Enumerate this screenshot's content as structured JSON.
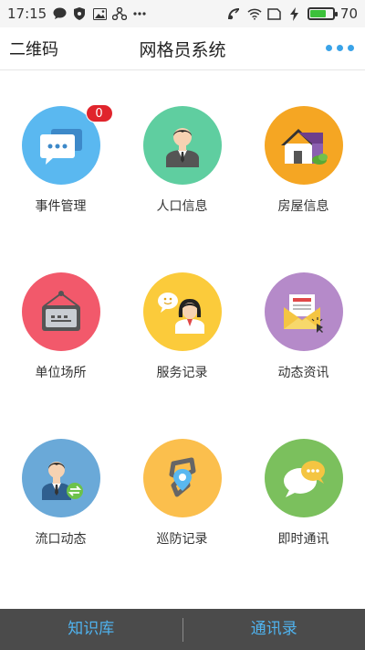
{
  "statusbar": {
    "time": "17:15",
    "left_icons": [
      "message-icon",
      "shield-icon",
      "image-icon",
      "usb-icon",
      "more-dots-icon"
    ],
    "right_icons": [
      "nfc-icon",
      "wifi-icon",
      "sim-icon",
      "charging-icon"
    ],
    "battery_level": 70,
    "battery_text": "70"
  },
  "header": {
    "left_label": "二维码",
    "title": "网格员系统",
    "more_icon": "more-dots-icon"
  },
  "tiles": [
    {
      "label": "事件管理",
      "icon": "chat-bubbles-icon",
      "color": "#5ab8f0",
      "badge": "0"
    },
    {
      "label": "人口信息",
      "icon": "person-suit-icon",
      "color": "#5fcea0"
    },
    {
      "label": "房屋信息",
      "icon": "house-icon",
      "color": "#f5a623"
    },
    {
      "label": "单位场所",
      "icon": "sign-board-icon",
      "color": "#f2596b"
    },
    {
      "label": "服务记录",
      "icon": "service-woman-icon",
      "color": "#fbcb3b"
    },
    {
      "label": "动态资讯",
      "icon": "envelope-icon",
      "color": "#b58ac9"
    },
    {
      "label": "流口动态",
      "icon": "person-transfer-icon",
      "color": "#6aa9d8"
    },
    {
      "label": "巡防记录",
      "icon": "location-pin-icon",
      "color": "#fbbf4d"
    },
    {
      "label": "即时通讯",
      "icon": "instant-chat-icon",
      "color": "#7bc05d"
    }
  ],
  "bottombar": {
    "left_label": "知识库",
    "right_label": "通讯录"
  }
}
